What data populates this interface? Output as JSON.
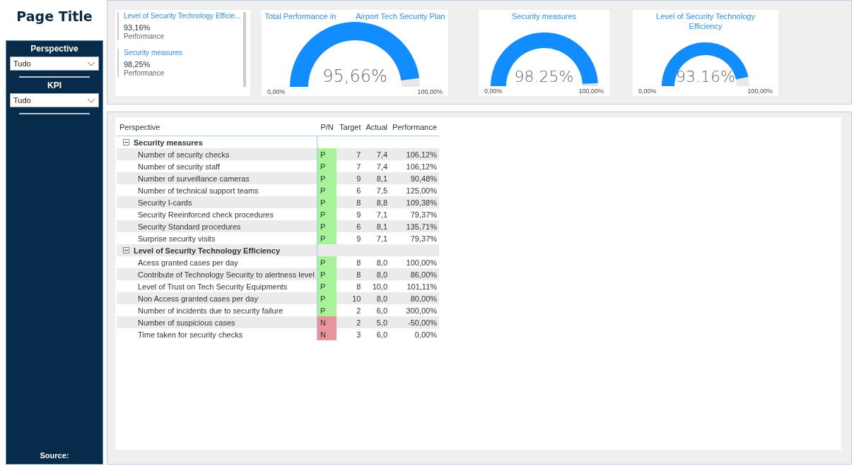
{
  "page_title": "Page Title",
  "sidebar": {
    "filters": [
      {
        "label": "Perspective",
        "value": "Tudo"
      },
      {
        "label": "KPI",
        "value": "Tudo"
      }
    ],
    "footer": "Source:"
  },
  "kpi_list": [
    {
      "title": "Level of Security Technology Efficie...",
      "value": "93,16%",
      "caption": "Performance"
    },
    {
      "title": "Security measures",
      "value": "98,25%",
      "caption": "Performance"
    }
  ],
  "gauges": [
    {
      "title_parts": [
        "Total Performance in",
        "Airport Tech Security Plan"
      ],
      "value": "95,66%",
      "level": 0.9566,
      "min": "0,00%",
      "max": "100,00%"
    },
    {
      "title_parts": [
        "Security measures"
      ],
      "value": "98.25%",
      "level": 0.9825,
      "min": "0,00%",
      "max": "100,00%"
    },
    {
      "title_parts": [
        "Level of Security Technology Efficiency"
      ],
      "value": "93.16%",
      "level": 0.9316,
      "min": "0,00%",
      "max": "100,00%"
    }
  ],
  "table": {
    "columns": [
      "Perspective",
      "P/N",
      "Target",
      "Actual",
      "Performance"
    ],
    "groups": [
      {
        "name": "Security measures",
        "expanded": true,
        "rows": [
          {
            "name": "Number of security checks",
            "pn": "P",
            "color": "#a6f39a",
            "target": "7",
            "actual": "7,4",
            "performance": "106,12%"
          },
          {
            "name": "Number of security staff",
            "pn": "P",
            "color": "#a6f39a",
            "target": "7",
            "actual": "7,4",
            "performance": "106,12%"
          },
          {
            "name": "Number of surveillance cameras",
            "pn": "P",
            "color": "#a6f39a",
            "target": "9",
            "actual": "8,1",
            "performance": "90,48%"
          },
          {
            "name": "Number of technical support teams",
            "pn": "P",
            "color": "#a6f39a",
            "target": "6",
            "actual": "7,5",
            "performance": "125,00%"
          },
          {
            "name": "Security I-cards",
            "pn": "P",
            "color": "#a6f39a",
            "target": "8",
            "actual": "8,8",
            "performance": "109,38%"
          },
          {
            "name": "Security Reeinforced check procedures",
            "pn": "P",
            "color": "#a6f39a",
            "target": "9",
            "actual": "7,1",
            "performance": "79,37%"
          },
          {
            "name": "Security Standard procedures",
            "pn": "P",
            "color": "#a6f39a",
            "target": "6",
            "actual": "8,1",
            "performance": "135,71%"
          },
          {
            "name": "Surprise security visits",
            "pn": "P",
            "color": "#a6f39a",
            "target": "9",
            "actual": "7,1",
            "performance": "79,37%"
          }
        ]
      },
      {
        "name": "Level of Security Technology Efficiency",
        "expanded": true,
        "rows": [
          {
            "name": "Acess granted cases per day",
            "pn": "P",
            "color": "#a6f39a",
            "target": "8",
            "actual": "8,0",
            "performance": "100,00%"
          },
          {
            "name": "Contribute of Technology Security to alertness level",
            "pn": "P",
            "color": "#a6f39a",
            "target": "8",
            "actual": "8,0",
            "performance": "86,00%"
          },
          {
            "name": "Level of Trust on Tech Security Equipments",
            "pn": "P",
            "color": "#a6f39a",
            "target": "8",
            "actual": "10,0",
            "performance": "101,11%"
          },
          {
            "name": "Non Access granted cases per day",
            "pn": "P",
            "color": "#a6f39a",
            "target": "10",
            "actual": "8,0",
            "performance": "80,00%"
          },
          {
            "name": "Number of incidents due to security failure",
            "pn": "P",
            "color": "#a6f39a",
            "target": "2",
            "actual": "6,0",
            "performance": "300,00%"
          },
          {
            "name": "Number of suspicious cases",
            "pn": "N",
            "color": "#e8949b",
            "target": "2",
            "actual": "5,0",
            "performance": "-50,00%"
          },
          {
            "name": "Time taken for security checks",
            "pn": "N",
            "color": "#e8949b",
            "target": "3",
            "actual": "6,0",
            "performance": "0,00%"
          }
        ]
      }
    ]
  }
}
